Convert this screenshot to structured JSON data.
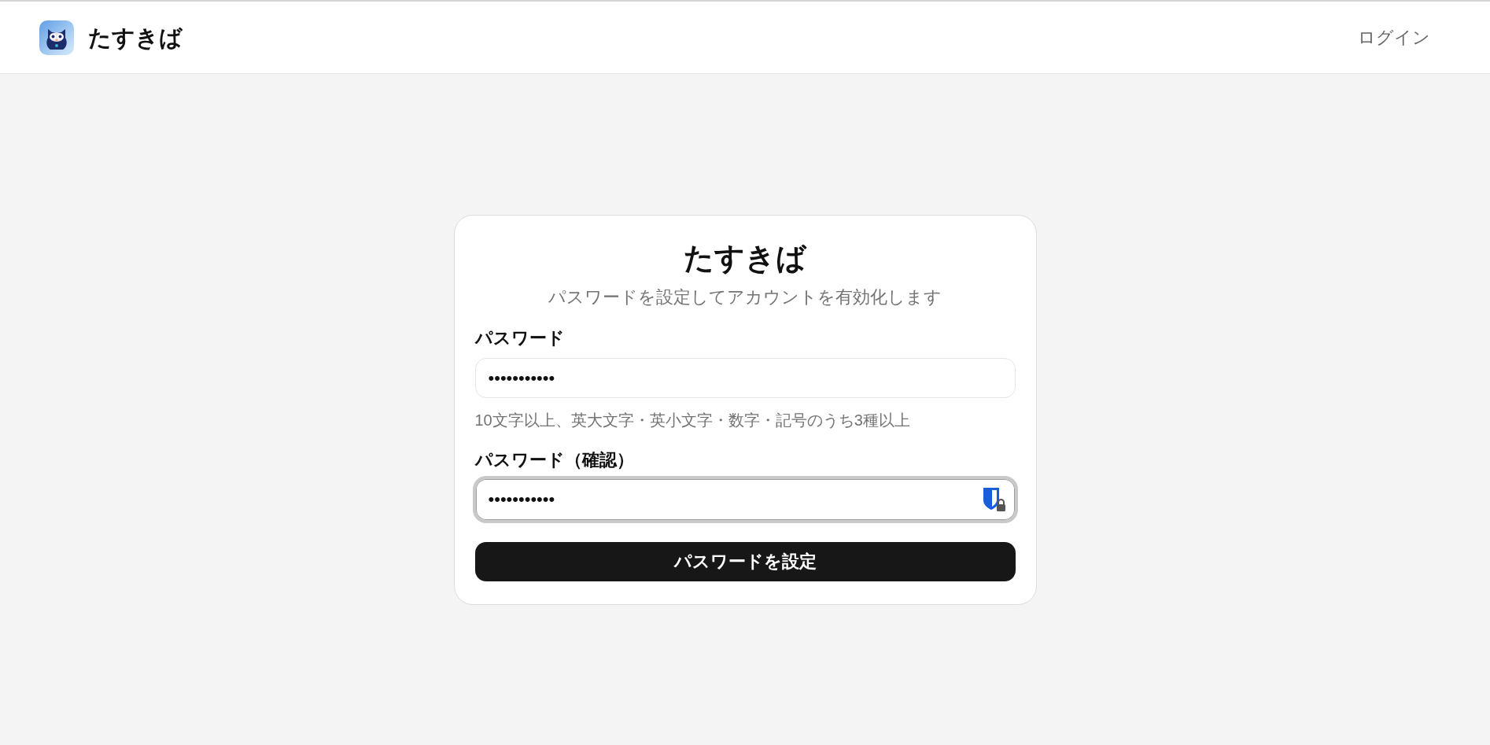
{
  "header": {
    "brand": "たすきば",
    "login_link": "ログイン"
  },
  "card": {
    "title": "たすきば",
    "subtitle": "パスワードを設定してアカウントを有効化します",
    "fields": [
      {
        "label": "パスワード",
        "value": "•••••••••••",
        "focused": false,
        "autofill_icon": false,
        "hint": "10文字以上、英大文字・英小文字・数字・記号のうち3種以上"
      },
      {
        "label": "パスワード（確認）",
        "value": "•••••••••••",
        "focused": true,
        "autofill_icon": true
      }
    ],
    "submit_button": "パスワードを設定"
  }
}
